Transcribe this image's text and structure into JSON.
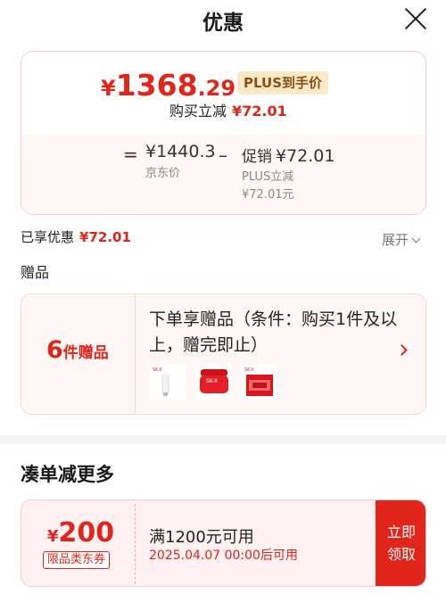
{
  "header": {
    "title": "优惠"
  },
  "price": {
    "yen": "¥",
    "integer": "1368",
    "decimal": ".29",
    "plus_label": "PLUS到手价",
    "buy_cut_label": "购买立减",
    "buy_cut_amount": "¥72.01"
  },
  "breakdown": {
    "equals": "=",
    "jd_price": "¥1440.3",
    "jd_label": "京东价",
    "minus": "–",
    "promo_label": "促销",
    "promo_amount": "¥72.01",
    "plus_cut_label": "PLUS立减",
    "plus_cut_amount": "¥72.01元"
  },
  "enjoyed": {
    "label": "已享优惠",
    "amount": "¥72.01",
    "expand_label": "展开"
  },
  "gift": {
    "section_title": "赠品",
    "count": "6",
    "count_unit": "件赠品",
    "description": "下单享赠品（条件：购买1件及以上，赠完即止）",
    "thumbnails": [
      "cleanser-tube",
      "red-cream-jar",
      "red-gift-box"
    ]
  },
  "combine": {
    "title": "凑单减更多",
    "coupon": {
      "yen": "¥",
      "amount": "200",
      "tag": "限品类东券",
      "condition": "满1200元可用",
      "valid_time": "2025.04.07 00:00后可用",
      "claim_line1": "立即",
      "claim_line2": "领取"
    }
  },
  "colors": {
    "accent": "#e1251b",
    "plus_tag_bg": "#fbe8c6",
    "plus_tag_text": "#8a4f12"
  }
}
